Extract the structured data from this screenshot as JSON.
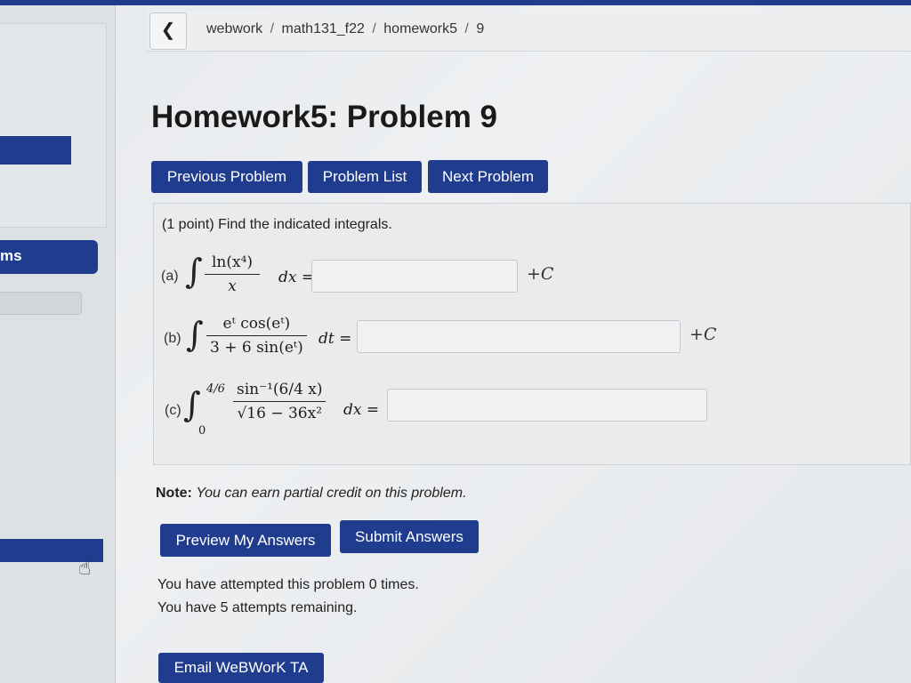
{
  "sidebar": {
    "item_partial": "ms"
  },
  "breadcrumb": {
    "back_icon": "chevron-left-icon",
    "parts": [
      "webwork",
      "math131_f22",
      "homework5",
      "9"
    ],
    "separator": "/"
  },
  "page_title": "Homework5: Problem 9",
  "nav": {
    "previous": "Previous Problem",
    "list": "Problem List",
    "next": "Next Problem"
  },
  "problem": {
    "intro": "(1 point) Find the indicated integrals.",
    "parts": [
      {
        "label": "(a)",
        "numerator": "ln(x⁴)",
        "denominator": "x",
        "differential": "dx =",
        "answer": "",
        "suffix": "+C"
      },
      {
        "label": "(b)",
        "numerator": "eᵗ cos(eᵗ)",
        "denominator": "3 + 6 sin(eᵗ)",
        "differential": "dt =",
        "answer": "",
        "suffix": "+C"
      },
      {
        "label": "(c)",
        "upper_limit": "4/6",
        "lower_limit": "0",
        "numerator": "sin⁻¹(6/4 x)",
        "denominator": "√16 − 36x²",
        "differential": "dx =",
        "answer": ""
      }
    ]
  },
  "note": {
    "label": "Note:",
    "text": "You can earn partial credit on this problem."
  },
  "actions": {
    "preview": "Preview My Answers",
    "submit": "Submit Answers"
  },
  "attempts": {
    "line1": "You have attempted this problem 0 times.",
    "line2": "You have 5 attempts remaining."
  },
  "email": "Email WeBWorK TA",
  "colors": {
    "accent": "#1f3c8f",
    "background": "#e8eaec"
  }
}
